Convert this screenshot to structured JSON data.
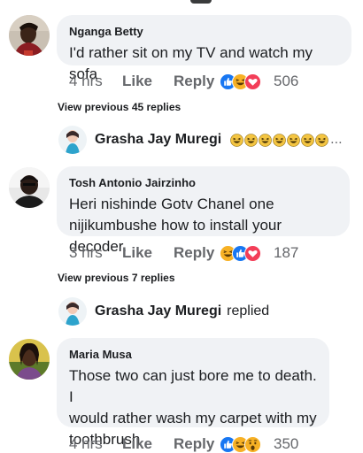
{
  "comments": [
    {
      "author": "Nganga Betty",
      "lines": [
        "I'd rather sit on my TV and watch my sofa"
      ],
      "time": "4 hrs",
      "like": "Like",
      "reply": "Reply",
      "reactions": [
        "like-icon",
        "haha-icon",
        "love-icon"
      ],
      "reaction_count": "506"
    },
    {
      "author": "Tosh Antonio Jairzinho",
      "lines": [
        "Heri nishinde Gotv Chanel one",
        "nijikumbushe how to install your decoder."
      ],
      "time": "3 hrs",
      "like": "Like",
      "reply": "Reply",
      "reactions": [
        "haha-icon",
        "like-icon",
        "love-icon"
      ],
      "reaction_count": "187"
    },
    {
      "author": "Maria Musa",
      "lines": [
        "Those two can just bore me to death. I",
        "would rather wash my carpet with my",
        "toothbrush"
      ],
      "time": "4 hrs",
      "like": "Like",
      "reply": "Reply",
      "reactions": [
        "like-icon",
        "haha-icon",
        "wow-icon"
      ],
      "reaction_count": "350"
    }
  ],
  "reply_threads": [
    {
      "view_previous": "View previous 45 replies",
      "author": "Grasha Jay Muregi",
      "trailing_text": "",
      "emoji": [
        "grinning-squint-icon",
        "grinning-squint-icon",
        "grinning-squint-icon",
        "grinning-squint-icon",
        "grinning-squint-icon",
        "grinning-squint-icon",
        "grinning-squint-icon"
      ],
      "ellipsis": "..."
    },
    {
      "view_previous": "View previous 7 replies",
      "author": "Grasha Jay Muregi",
      "trailing_text": "replied"
    }
  ],
  "colors": {
    "bubble": "#f0f2f5",
    "meta_text": "#65676b",
    "like_blue": "#1877f2",
    "love_red": "#f33e58",
    "haha_yellow": "#f7b125"
  }
}
